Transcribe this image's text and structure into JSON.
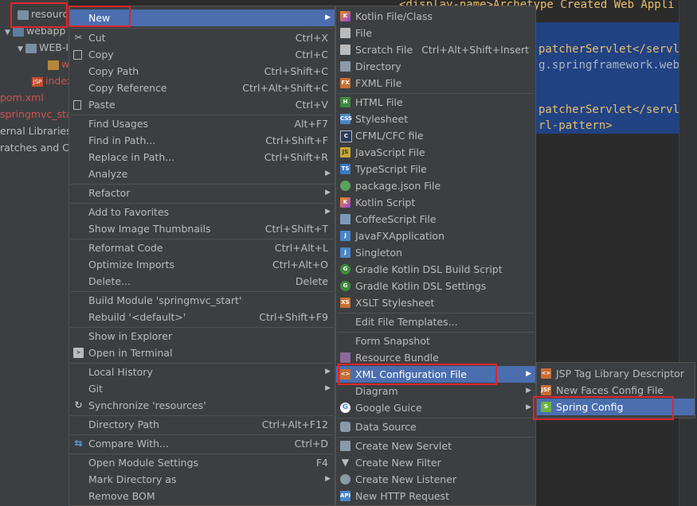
{
  "project_tree": {
    "rows": [
      {
        "label": "resources"
      },
      {
        "label": "webapp"
      },
      {
        "label": "WEB-INF"
      },
      {
        "label": "w"
      },
      {
        "label": "index"
      },
      {
        "label": "pom.xml"
      },
      {
        "label": "springmvc_start"
      },
      {
        "label": "ernal Libraries"
      },
      {
        "label": "ratches and Co"
      }
    ]
  },
  "editor": {
    "lines": [
      {
        "text": "<display-name>Archetype Created Web Appli"
      },
      {
        "text": "patcherServlet</servle"
      },
      {
        "text": "g.springframework.web."
      },
      {
        "text": "patcherServlet</servle"
      },
      {
        "text": "rl-pattern>"
      }
    ]
  },
  "context_menu": {
    "items": [
      {
        "label": "New",
        "shortcut": "",
        "submenu": true,
        "selected": true
      },
      {
        "label": "Cut",
        "shortcut": "Ctrl+X",
        "icon": "cut-icon"
      },
      {
        "label": "Copy",
        "shortcut": "Ctrl+C",
        "icon": "copy-icon"
      },
      {
        "label": "Copy Path",
        "shortcut": "Ctrl+Shift+C"
      },
      {
        "label": "Copy Reference",
        "shortcut": "Ctrl+Alt+Shift+C"
      },
      {
        "label": "Paste",
        "shortcut": "Ctrl+V",
        "icon": "paste-icon"
      },
      {
        "label": "Find Usages",
        "shortcut": "Alt+F7"
      },
      {
        "label": "Find in Path...",
        "shortcut": "Ctrl+Shift+F"
      },
      {
        "label": "Replace in Path...",
        "shortcut": "Ctrl+Shift+R"
      },
      {
        "label": "Analyze",
        "submenu": true
      },
      {
        "label": "Refactor",
        "submenu": true
      },
      {
        "label": "Add to Favorites",
        "submenu": true
      },
      {
        "label": "Show Image Thumbnails",
        "shortcut": "Ctrl+Shift+T"
      },
      {
        "label": "Reformat Code",
        "shortcut": "Ctrl+Alt+L"
      },
      {
        "label": "Optimize Imports",
        "shortcut": "Ctrl+Alt+O"
      },
      {
        "label": "Delete...",
        "shortcut": "Delete"
      },
      {
        "label": "Build Module 'springmvc_start'"
      },
      {
        "label": "Rebuild '<default>'",
        "shortcut": "Ctrl+Shift+F9"
      },
      {
        "label": "Show in Explorer"
      },
      {
        "label": "Open in Terminal",
        "icon": "terminal-icon"
      },
      {
        "label": "Local History",
        "submenu": true
      },
      {
        "label": "Git",
        "submenu": true
      },
      {
        "label": "Synchronize 'resources'",
        "icon": "sync-icon"
      },
      {
        "label": "Directory Path",
        "shortcut": "Ctrl+Alt+F12"
      },
      {
        "label": "Compare With...",
        "shortcut": "Ctrl+D",
        "icon": "compare-icon"
      },
      {
        "label": "Open Module Settings",
        "shortcut": "F4"
      },
      {
        "label": "Mark Directory as",
        "submenu": true
      },
      {
        "label": "Remove BOM"
      }
    ]
  },
  "new_menu": {
    "items": [
      {
        "label": "Kotlin File/Class",
        "icon": "kotlin-icon"
      },
      {
        "label": "File",
        "icon": "file-icon"
      },
      {
        "label": "Scratch File",
        "shortcut": "Ctrl+Alt+Shift+Insert",
        "icon": "scratch-icon"
      },
      {
        "label": "Directory",
        "icon": "folder-icon"
      },
      {
        "label": "FXML File",
        "icon": "fxml-icon"
      },
      {
        "label": "HTML File",
        "icon": "html-icon"
      },
      {
        "label": "Stylesheet",
        "icon": "css-icon"
      },
      {
        "label": "CFML/CFC file",
        "icon": "cfml-icon"
      },
      {
        "label": "JavaScript File",
        "icon": "js-icon"
      },
      {
        "label": "TypeScript File",
        "icon": "ts-icon"
      },
      {
        "label": "package.json File",
        "icon": "npm-icon"
      },
      {
        "label": "Kotlin Script",
        "icon": "kotlin-script-icon"
      },
      {
        "label": "CoffeeScript File",
        "icon": "coffee-icon"
      },
      {
        "label": "JavaFXApplication",
        "icon": "javafx-icon"
      },
      {
        "label": "Singleton",
        "icon": "singleton-icon"
      },
      {
        "label": "Gradle Kotlin DSL Build Script",
        "icon": "gradle-icon"
      },
      {
        "label": "Gradle Kotlin DSL Settings",
        "icon": "gradle-icon"
      },
      {
        "label": "XSLT Stylesheet",
        "icon": "xslt-icon"
      },
      {
        "label": "Edit File Templates..."
      },
      {
        "label": "Form Snapshot"
      },
      {
        "label": "Resource Bundle",
        "icon": "resource-bundle-icon"
      },
      {
        "label": "XML Configuration File",
        "icon": "xml-icon",
        "submenu": true,
        "selected": true
      },
      {
        "label": "Diagram",
        "submenu": true
      },
      {
        "label": "Google Guice",
        "icon": "google-icon",
        "submenu": true
      },
      {
        "label": "Data Source",
        "icon": "database-icon"
      },
      {
        "label": "Create New Servlet",
        "icon": "servlet-icon"
      },
      {
        "label": "Create New Filter",
        "icon": "filter-icon"
      },
      {
        "label": "Create New Listener",
        "icon": "listener-icon"
      },
      {
        "label": "New HTTP Request",
        "icon": "api-icon"
      }
    ]
  },
  "xml_menu": {
    "items": [
      {
        "label": "JSP Tag Library Descriptor",
        "icon": "tld-icon"
      },
      {
        "label": "New Faces Config File",
        "icon": "jsf-icon"
      },
      {
        "label": "Spring Config",
        "icon": "spring-icon",
        "selected": true
      }
    ]
  },
  "colors": {
    "menu_bg": "#3c3f41",
    "selection": "#4b6eaf",
    "highlight_box": "#e0262d",
    "editor_selection": "#214283"
  }
}
